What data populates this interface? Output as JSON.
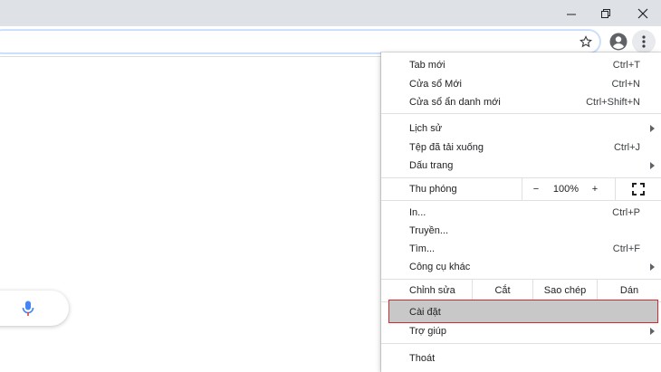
{
  "window": {
    "buttons": [
      "minimize",
      "restore",
      "close"
    ]
  },
  "toolbar": {
    "icons": [
      "star-icon",
      "profile-icon",
      "more-icon"
    ]
  },
  "menu": {
    "group1": [
      {
        "label": "Tab mới",
        "shortcut": "Ctrl+T"
      },
      {
        "label": "Cửa sổ Mới",
        "shortcut": "Ctrl+N"
      },
      {
        "label": "Cửa sổ ẩn danh mới",
        "shortcut": "Ctrl+Shift+N"
      }
    ],
    "group2": [
      {
        "label": "Lịch sử",
        "shortcut": ""
      },
      {
        "label": "Tệp đã tải xuống",
        "shortcut": "Ctrl+J"
      },
      {
        "label": "Dấu trang",
        "shortcut": ""
      }
    ],
    "zoom": {
      "label": "Thu phóng",
      "minus": "−",
      "value": "100%",
      "plus": "+"
    },
    "group3": [
      {
        "label": "In...",
        "shortcut": "Ctrl+P"
      },
      {
        "label": "Truyền...",
        "shortcut": ""
      },
      {
        "label": "Tìm...",
        "shortcut": "Ctrl+F"
      },
      {
        "label": "Công cụ khác",
        "shortcut": ""
      }
    ],
    "edit": {
      "label": "Chỉnh sửa",
      "cut": "Cắt",
      "copy": "Sao chép",
      "paste": "Dán"
    },
    "group4": [
      {
        "label": "Cài đặt",
        "shortcut": ""
      },
      {
        "label": "Trợ giúp",
        "shortcut": ""
      }
    ],
    "exit": {
      "label": "Thoát"
    }
  },
  "colors": {
    "highlight_border": "#e0242b",
    "highlight_fill": "#c8c8c8",
    "mic_blue": "#4285f4",
    "mic_red": "#ea4335"
  }
}
